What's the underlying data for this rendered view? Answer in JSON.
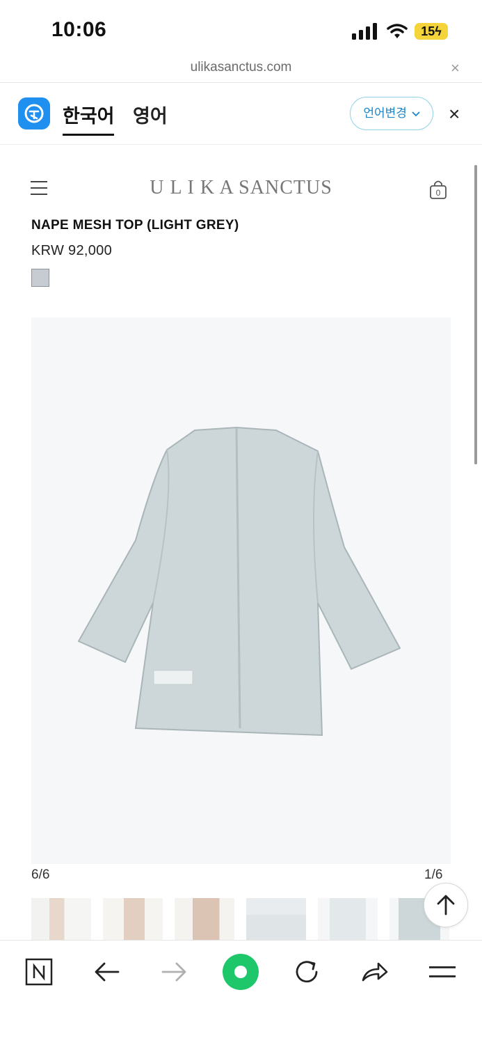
{
  "status_bar": {
    "time": "10:06",
    "battery": "15"
  },
  "browser": {
    "url": "ulikasanctus.com",
    "close_glyph": "×"
  },
  "translate_bar": {
    "tabs": [
      {
        "label": "한국어",
        "active": true
      },
      {
        "label": "영어",
        "active": false
      }
    ],
    "change_language_label": "언어변경",
    "close_glyph": "×"
  },
  "site": {
    "logo_text": "U L I K A SANCTUS",
    "cart_count": "0"
  },
  "product": {
    "title": "NAPE MESH TOP (LIGHT GREY)",
    "price": "KRW 92,000",
    "swatch_color": "#c6ccd1",
    "image_counter_left": "6/6",
    "image_counter_right": "1/6",
    "thumbnail_count": 6
  },
  "bottom_nav": {
    "icons": [
      "naver-home-icon",
      "back-arrow-icon",
      "forward-arrow-icon",
      "green-voice-icon",
      "reload-icon",
      "share-icon",
      "menu-icon"
    ]
  },
  "colors": {
    "accent_blue": "#1f8ff0",
    "green": "#1ec76a",
    "battery": "#f4d33b"
  }
}
